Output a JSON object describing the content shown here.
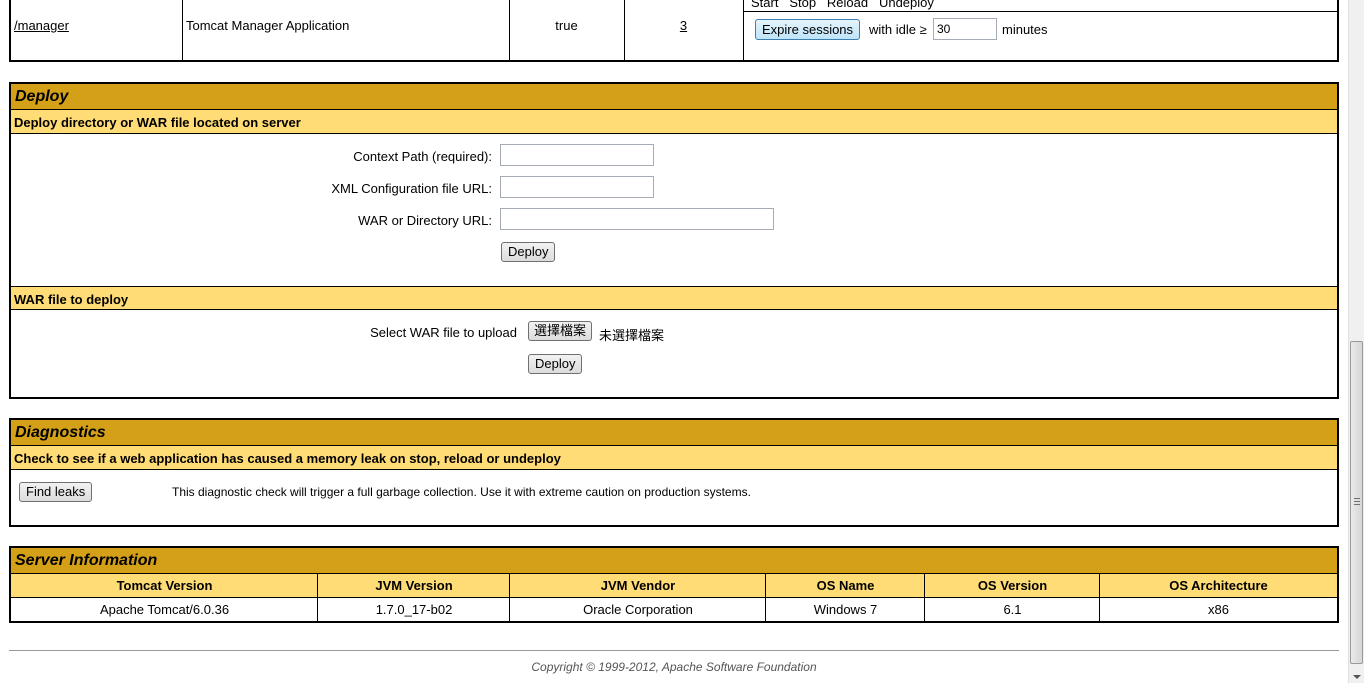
{
  "app_row": {
    "path": "/manager",
    "display_name": "Tomcat Manager Application",
    "running": "true",
    "sessions": "3",
    "commands": [
      "Start",
      "Stop",
      "Reload",
      "Undeploy"
    ],
    "expire_button": "Expire sessions",
    "with_idle": "with idle ≥",
    "idle_value": "30",
    "minutes": "minutes"
  },
  "deploy": {
    "title": "Deploy",
    "server_subtitle": "Deploy directory or WAR file located on server",
    "context_path_label": "Context Path (required):",
    "xml_config_label": "XML Configuration file URL:",
    "war_dir_label": "WAR or Directory URL:",
    "deploy_button": "Deploy",
    "war_subtitle": "WAR file to deploy",
    "select_war_label": "Select WAR file to upload",
    "choose_file_button": "選擇檔案",
    "no_file_text": "未選擇檔案",
    "upload_deploy_button": "Deploy"
  },
  "diagnostics": {
    "title": "Diagnostics",
    "subtitle": "Check to see if a web application has caused a memory leak on stop, reload or undeploy",
    "find_leaks_button": "Find leaks",
    "description": "This diagnostic check will trigger a full garbage collection. Use it with extreme caution on production systems."
  },
  "server_info": {
    "title": "Server Information",
    "headers": [
      "Tomcat Version",
      "JVM Version",
      "JVM Vendor",
      "OS Name",
      "OS Version",
      "OS Architecture"
    ],
    "values": [
      "Apache Tomcat/6.0.36",
      "1.7.0_17-b02",
      "Oracle Corporation",
      "Windows 7",
      "6.1",
      "x86"
    ]
  },
  "footer": {
    "copyright": "Copyright © 1999-2012, Apache Software Foundation"
  },
  "colors": {
    "section_header": "#d4a017",
    "sub_header": "#ffdc75"
  }
}
